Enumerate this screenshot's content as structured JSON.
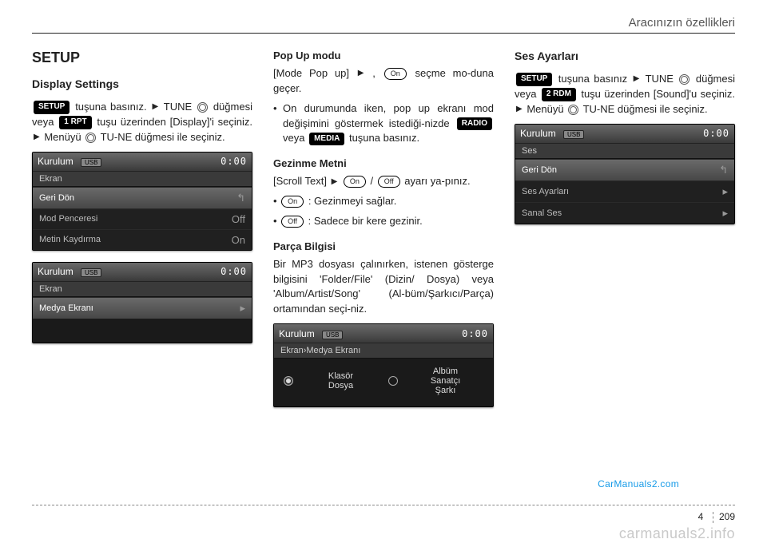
{
  "header": {
    "title": "Aracınızın özellikleri"
  },
  "col1": {
    "h1": "SETUP",
    "h2": "Display Settings",
    "p1_a": "tuşuna basınız.",
    "p1_b": "TUNE",
    "p1_c": "düğmesi  veya",
    "p1_d": "tuşu  üzerinden [Display]'i seçiniz.",
    "p1_e": "Menüyü",
    "p1_f": "TU-NE düğmesi ile seçiniz.",
    "btn_setup": "SETUP",
    "btn_1rpt": "1 RPT",
    "screen1": {
      "title": "Kurulum",
      "badge": "USB",
      "clock": "0:00",
      "sub": "Ekran",
      "rows": [
        {
          "label": "Geri Dön",
          "val": "↰",
          "hl": true
        },
        {
          "label": "Mod Penceresi",
          "val": "Off"
        },
        {
          "label": "Metin Kaydırma",
          "val": "On"
        }
      ]
    },
    "screen2": {
      "title": "Kurulum",
      "badge": "USB",
      "clock": "0:00",
      "sub": "Ekran",
      "rows": [
        {
          "label": "Medya Ekranı",
          "val": "▸",
          "hl": true
        }
      ]
    }
  },
  "col2": {
    "h3a": "Pop Up modu",
    "p2_a": "[Mode Pop up]",
    "p2_b": ",",
    "p2_c": "seçme mo-duna geçer.",
    "bullet1_a": "On durumunda iken, pop up ekranı mod değişimini göstermek istediği-nizde",
    "bullet1_b": "veya",
    "bullet1_c": "tuşuna basınız.",
    "btn_radio": "RADIO",
    "btn_media": "MEDIA",
    "pill_on": "On",
    "pill_off": "Off",
    "h3b": "Gezinme Metni",
    "p3_a": "[Scroll Text]",
    "p3_b": "/",
    "p3_c": "ayarı ya-pınız.",
    "b_on": ": Gezinmeyi sağlar.",
    "b_off": ": Sadece bir kere gezinir.",
    "h3c": "Parça Bilgisi",
    "p4": "Bir MP3 dosyası çalınırken, istenen gösterge bilgisini 'Folder/File' (Dizin/ Dosya) veya 'Album/Artist/Song' (Al-büm/Şarkıcı/Parça) ortamından seçi-niz.",
    "screen3": {
      "title": "Kurulum",
      "badge": "USB",
      "clock": "0:00",
      "sub": "Ekran›Medya Ekranı",
      "opt1_l1": "Klasör",
      "opt1_l2": "Dosya",
      "opt2_l1": "Albüm",
      "opt2_l2": "Sanatçı",
      "opt2_l3": "Şarkı"
    }
  },
  "col3": {
    "h2": "Ses Ayarları",
    "btn_setup": "SETUP",
    "btn_2rdm": "2 RDM",
    "p1_a": "tuşuna basınız",
    "p1_b": "TUNE",
    "p1_c": "düğmesi  veya",
    "p1_d": "tuşu  üzerinden [Sound]'u seçiniz.",
    "p1_e": "Menüyü",
    "p1_f": "TU-NE düğmesi ile seçiniz.",
    "screen4": {
      "title": "Kurulum",
      "badge": "USB",
      "clock": "0:00",
      "sub": "Ses",
      "rows": [
        {
          "label": "Geri Dön",
          "val": "↰",
          "hl": true
        },
        {
          "label": "Ses Ayarları",
          "val": "▸"
        },
        {
          "label": "Sanal Ses",
          "val": "▸"
        }
      ]
    }
  },
  "watermarks": {
    "blue": "CarManuals2.com",
    "grey": "carmanuals2.info"
  },
  "footer": {
    "section": "4",
    "page": "209"
  }
}
